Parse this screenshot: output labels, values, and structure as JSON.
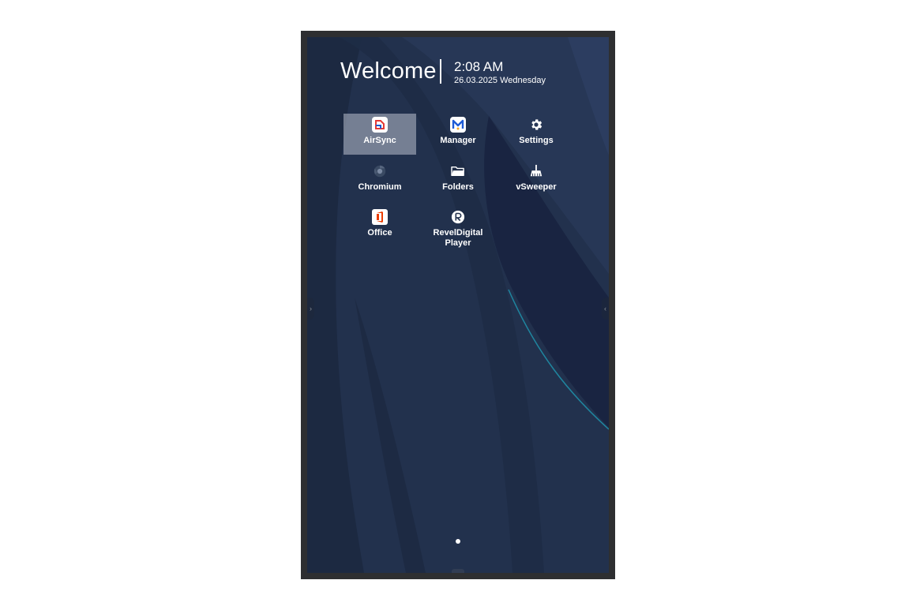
{
  "header": {
    "welcome": "Welcome",
    "time": "2:08 AM",
    "date": "26.03.2025 Wednesday"
  },
  "apps": [
    {
      "label": "AirSync",
      "icon": "airsync-icon",
      "selected": true
    },
    {
      "label": "Manager",
      "icon": "manager-icon"
    },
    {
      "label": "Settings",
      "icon": "gear-icon"
    },
    {
      "label": "Chromium",
      "icon": "chromium-icon"
    },
    {
      "label": "Folders",
      "icon": "folder-icon"
    },
    {
      "label": "vSweeper",
      "icon": "broom-icon"
    },
    {
      "label": "Office",
      "icon": "office-icon"
    },
    {
      "label": "RevelDigital\nPlayer",
      "icon": "reveldigital-icon"
    }
  ],
  "edges": {
    "left": "›",
    "right": "‹"
  },
  "pager": {
    "current": 1,
    "total": 1
  },
  "colors": {
    "bezel": "#2e2f31",
    "wallpaper_base": "#22314d",
    "selection": "#8f97a5",
    "accent_teal": "#1f8fa8"
  }
}
